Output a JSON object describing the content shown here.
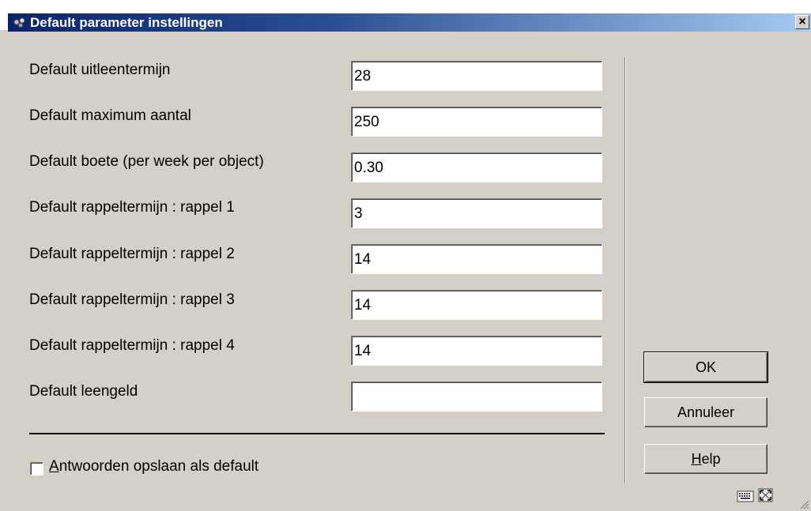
{
  "window": {
    "title": "Default parameter instellingen",
    "close_glyph": "×"
  },
  "form": {
    "fields": [
      {
        "label": "Default uitleentermijn",
        "value": "28"
      },
      {
        "label": "Default maximum aantal",
        "value": "250"
      },
      {
        "label": "Default boete (per week per object)",
        "value": "0.30"
      },
      {
        "label": "Default rappeltermijn : rappel 1",
        "value": "3"
      },
      {
        "label": "Default rappeltermijn : rappel 2",
        "value": "14"
      },
      {
        "label": "Default rappeltermijn : rappel 3",
        "value": "14"
      },
      {
        "label": "Default rappeltermijn : rappel 4",
        "value": "14"
      },
      {
        "label": "Default leengeld",
        "value": ""
      }
    ],
    "save_default": {
      "label_accel": "A",
      "label_rest": "ntwoorden opslaan als default",
      "checked": false
    }
  },
  "buttons": {
    "ok": "OK",
    "cancel": "Annuleer",
    "help_accel": "H",
    "help_rest": "elp"
  },
  "icons": {
    "title": "app-icon",
    "status1": "keyboard-icon",
    "status2": "maximize-icon"
  }
}
